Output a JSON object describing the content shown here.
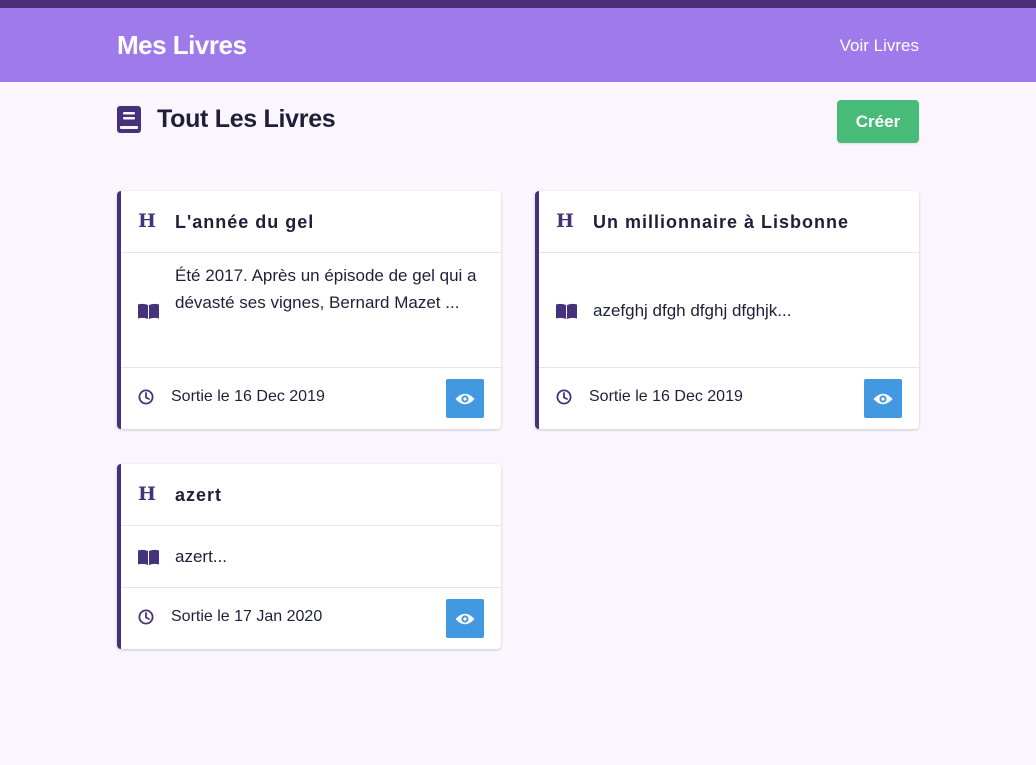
{
  "navbar": {
    "brand": "Mes Livres",
    "link": "Voir Livres"
  },
  "page": {
    "title": "Tout Les Livres",
    "create_label": "Créer",
    "title_icon": "book-icon"
  },
  "colors": {
    "nav": "#9f7aea",
    "accent": "#44337a",
    "create": "#48bb78",
    "view": "#4299e1"
  },
  "books": [
    {
      "title": "L'année du gel",
      "description": "Été 2017. Après un épisode de gel qui a dévasté ses vignes, Bernard Mazet ...",
      "date": "Sortie le 16 Dec 2019"
    },
    {
      "title": "Un millionnaire à Lisbonne",
      "description": "azefghj dfgh dfghj dfghjk...",
      "date": "Sortie le 16 Dec 2019"
    },
    {
      "title": "azert",
      "description": "azert...",
      "date": "Sortie le 17 Jan 2020"
    }
  ]
}
